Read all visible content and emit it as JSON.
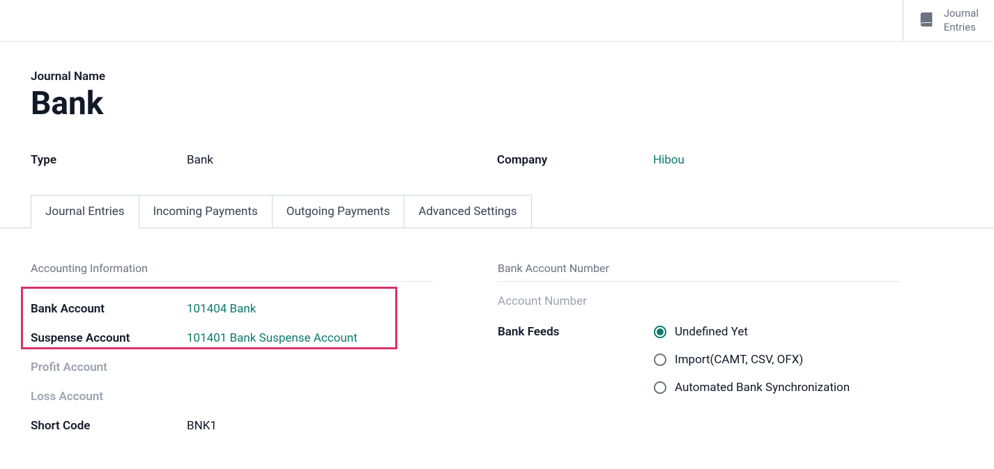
{
  "topbar": {
    "journal_entries_line1": "Journal",
    "journal_entries_line2": "Entries"
  },
  "header": {
    "journal_name_label": "Journal Name",
    "journal_name_value": "Bank",
    "type_label": "Type",
    "type_value": "Bank",
    "company_label": "Company",
    "company_value": "Hibou"
  },
  "tabs": {
    "journal_entries": "Journal Entries",
    "incoming_payments": "Incoming Payments",
    "outgoing_payments": "Outgoing Payments",
    "advanced_settings": "Advanced Settings"
  },
  "left_section": {
    "title": "Accounting Information",
    "bank_account_label": "Bank Account",
    "bank_account_value": "101404 Bank",
    "suspense_account_label": "Suspense Account",
    "suspense_account_value": "101401 Bank Suspense Account",
    "profit_account_label": "Profit Account",
    "loss_account_label": "Loss Account",
    "short_code_label": "Short Code",
    "short_code_value": "BNK1"
  },
  "right_section": {
    "title": "Bank Account Number",
    "account_number_label": "Account Number",
    "bank_feeds_label": "Bank Feeds",
    "feeds": {
      "undef": "Undefined Yet",
      "import": "Import(CAMT, CSV, OFX)",
      "auto": "Automated Bank Synchronization"
    },
    "selected": "undef"
  }
}
